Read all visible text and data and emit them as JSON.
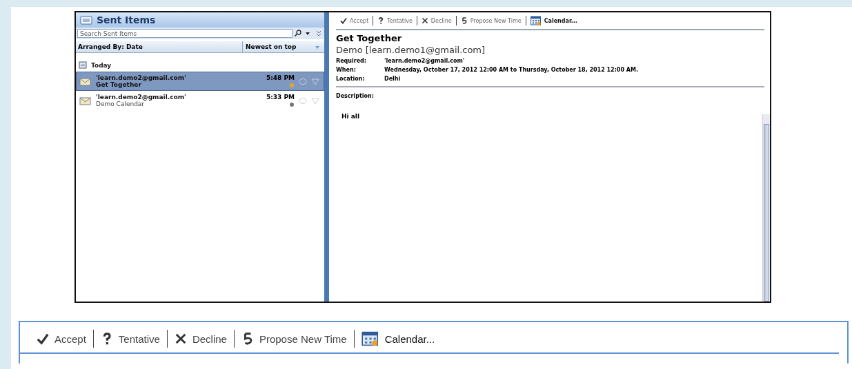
{
  "folder_pane": {
    "title": "Sent Items",
    "search": {
      "placeholder": "Search Sent Items"
    },
    "arranged_by": "Arranged By: Date",
    "sort_order": "Newest on top",
    "groups": [
      {
        "label": "Today",
        "expanded": true,
        "items": [
          {
            "sender": "'learn.demo2@gmail.com'",
            "subject": "Get Together",
            "time": "5:48 PM",
            "selected": true
          },
          {
            "sender": "'learn.demo2@gmail.com'",
            "subject": "Demo Calendar",
            "time": "5:33 PM",
            "selected": false
          }
        ]
      }
    ]
  },
  "reading_pane": {
    "toolbar": [
      {
        "kind": "accept",
        "label": "Accept"
      },
      {
        "kind": "tentative",
        "label": "Tentative"
      },
      {
        "kind": "decline",
        "label": "Decline"
      },
      {
        "kind": "propose",
        "label": "Propose New Time"
      },
      {
        "kind": "calendar",
        "label": "Calendar..."
      }
    ],
    "subject": "Get Together",
    "from": "Demo [learn.demo1@gmail.com]",
    "fields": [
      {
        "label": "Required:",
        "value": "'learn.demo2@gmail.com'"
      },
      {
        "label": "When:",
        "value": "Wednesday, October 17, 2012 12:00 AM to Thursday, October 18, 2012 12:00 AM."
      },
      {
        "label": "Location:",
        "value": "Delhi"
      }
    ],
    "description_label": "Description:",
    "body": "Hi all"
  },
  "toolbar_closeup": [
    {
      "kind": "accept",
      "label": "Accept"
    },
    {
      "kind": "tentative",
      "label": "Tentative"
    },
    {
      "kind": "decline",
      "label": "Decline"
    },
    {
      "kind": "propose",
      "label": "Propose New Time"
    },
    {
      "kind": "calendar",
      "label": "Calendar..."
    }
  ]
}
